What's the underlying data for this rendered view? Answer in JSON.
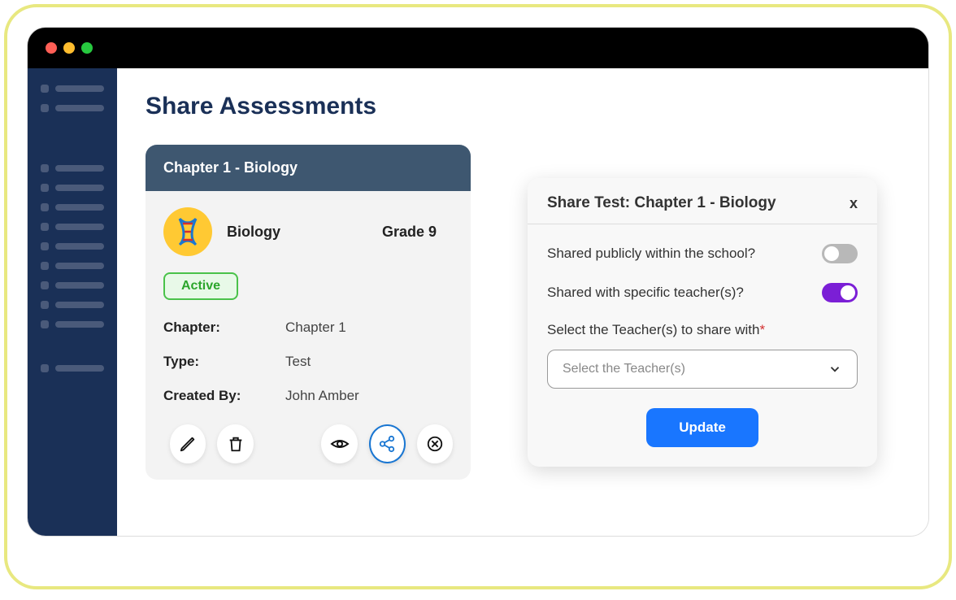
{
  "page": {
    "title": "Share Assessments"
  },
  "card": {
    "title": "Chapter 1 - Biology",
    "subject": "Biology",
    "grade": "Grade 9",
    "status": "Active",
    "info": {
      "chapter_label": "Chapter:",
      "chapter": "Chapter 1",
      "type_label": "Type:",
      "type": "Test",
      "createdby_label": "Created By:",
      "createdby": "John Amber"
    }
  },
  "modal": {
    "title": "Share Test: Chapter 1 - Biology",
    "close": "x",
    "opt1": "Shared publicly within the school?",
    "opt1_on": false,
    "opt2": "Shared with specific teacher(s)?",
    "opt2_on": true,
    "select_label": "Select the Teacher(s) to share with",
    "select_placeholder": "Select the Teacher(s)",
    "update": "Update"
  }
}
